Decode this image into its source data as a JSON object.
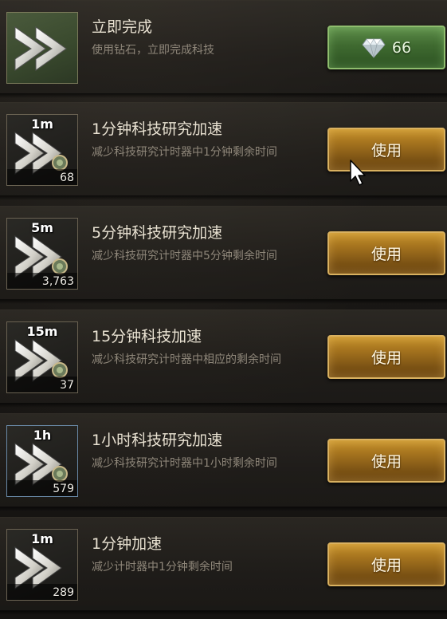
{
  "rows": [
    {
      "title": "立即完成",
      "desc": "使用钻石，立即完成科技",
      "button_kind": "diamond",
      "cost": "66",
      "diamond_icon": "diamond-icon",
      "icon": "double-arrow-icon"
    },
    {
      "tag": "1m",
      "title": "1分钟科技研究加速",
      "desc": "减少科技研究计时器中1分钟剩余时间",
      "count": "68",
      "button": "使用",
      "icon": "speedup-arrow-icon"
    },
    {
      "tag": "5m",
      "title": "5分钟科技研究加速",
      "desc": "减少科技研究计时器中5分钟剩余时间",
      "count": "3,763",
      "button": "使用",
      "icon": "speedup-arrow-icon"
    },
    {
      "tag": "15m",
      "title": "15分钟科技加速",
      "desc": "减少科技研究计时器中相应的剩余时间",
      "count": "37",
      "button": "使用",
      "icon": "speedup-arrow-icon"
    },
    {
      "tag": "1h",
      "title": "1小时科技研究加速",
      "desc": "减少科技研究计时器中1小时剩余时间",
      "count": "579",
      "button": "使用",
      "icon": "speedup-arrow-icon"
    },
    {
      "tag": "1m",
      "title": "1分钟加速",
      "desc": "减少计时器中1分钟剩余时间",
      "count": "289",
      "button": "使用",
      "icon": "speedup-arrow-icon"
    }
  ],
  "colors": {
    "use_button": "#a8761f",
    "diamond_button": "#3f6a30",
    "title_text": "#e9e2d2",
    "desc_text": "#8f877a"
  }
}
